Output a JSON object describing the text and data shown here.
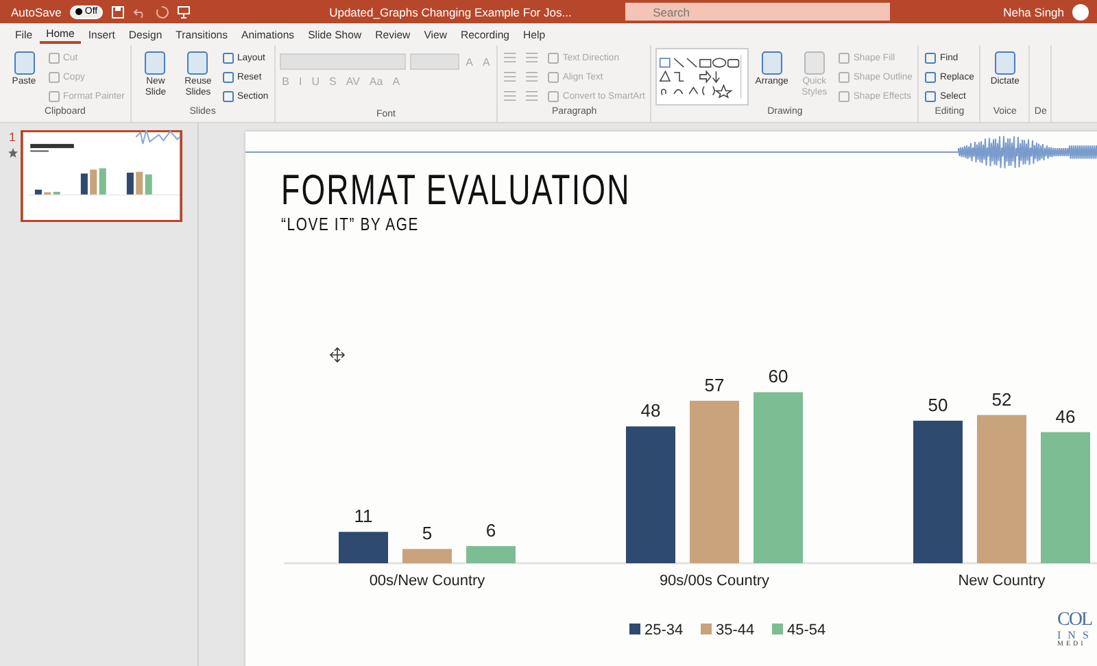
{
  "title_bar": {
    "autosave_label": "AutoSave",
    "autosave_toggle": {
      "label": "Off",
      "on": false
    },
    "file_name": "Updated_Graphs Changing Example For Jos...",
    "search": {
      "placeholder": "Search"
    },
    "user_name": "Neha Singh"
  },
  "tabs": [
    {
      "label": "File",
      "selected": false
    },
    {
      "label": "Home",
      "selected": true
    },
    {
      "label": "Insert",
      "selected": false
    },
    {
      "label": "Design",
      "selected": false
    },
    {
      "label": "Transitions",
      "selected": false
    },
    {
      "label": "Animations",
      "selected": false
    },
    {
      "label": "Slide Show",
      "selected": false
    },
    {
      "label": "Review",
      "selected": false
    },
    {
      "label": "View",
      "selected": false
    },
    {
      "label": "Recording",
      "selected": false
    },
    {
      "label": "Help",
      "selected": false
    }
  ],
  "ribbon": {
    "groups": [
      {
        "name": "Clipboard",
        "items": [
          {
            "kind": "large",
            "label": "Paste",
            "disabled": false
          },
          {
            "kind": "small",
            "label": "Cut",
            "disabled": true
          },
          {
            "kind": "small",
            "label": "Copy",
            "disabled": true
          },
          {
            "kind": "small",
            "label": "Format Painter",
            "disabled": true
          }
        ]
      },
      {
        "name": "Slides",
        "items": [
          {
            "kind": "large",
            "label": "New Slide",
            "disabled": false
          },
          {
            "kind": "large",
            "label": "Reuse Slides",
            "disabled": false
          },
          {
            "kind": "small",
            "label": "Layout",
            "disabled": false
          },
          {
            "kind": "small",
            "label": "Reset",
            "disabled": false
          },
          {
            "kind": "small",
            "label": "Section",
            "disabled": false
          }
        ]
      },
      {
        "name": "Font",
        "rows": [
          [
            {
              "kind": "combo",
              "disabled": true
            },
            {
              "kind": "combo",
              "disabled": true
            },
            {
              "kind": "glyph",
              "label": "A",
              "disabled": true
            },
            {
              "kind": "glyph",
              "label": "A",
              "disabled": true
            }
          ],
          [
            {
              "kind": "glyph",
              "label": "B",
              "disabled": true
            },
            {
              "kind": "glyph",
              "label": "I",
              "disabled": true
            },
            {
              "kind": "glyph",
              "label": "U",
              "disabled": true
            },
            {
              "kind": "glyph",
              "label": "S",
              "disabled": true
            },
            {
              "kind": "glyph",
              "label": "AV",
              "disabled": true
            },
            {
              "kind": "glyph",
              "label": "Aa",
              "disabled": true
            },
            {
              "kind": "glyph",
              "label": "A",
              "disabled": true
            }
          ]
        ]
      },
      {
        "name": "Paragraph",
        "items": [
          {
            "kind": "tool",
            "disabled": true
          },
          {
            "kind": "tool",
            "disabled": true
          },
          {
            "kind": "tool",
            "disabled": true
          },
          {
            "kind": "tool",
            "disabled": true
          },
          {
            "kind": "tool",
            "disabled": true
          },
          {
            "kind": "tool",
            "disabled": true
          },
          {
            "kind": "small",
            "label": "Text Direction",
            "disabled": true
          },
          {
            "kind": "small",
            "label": "Align Text",
            "disabled": true
          },
          {
            "kind": "small",
            "label": "Convert to SmartArt",
            "disabled": true
          }
        ]
      },
      {
        "name": "Drawing",
        "items": [
          {
            "kind": "gallery",
            "disabled": false
          },
          {
            "kind": "large",
            "label": "Arrange",
            "disabled": false
          },
          {
            "kind": "large",
            "label": "Quick Styles",
            "disabled": true
          },
          {
            "kind": "small",
            "label": "Shape Fill",
            "disabled": true
          },
          {
            "kind": "small",
            "label": "Shape Outline",
            "disabled": true
          },
          {
            "kind": "small",
            "label": "Shape Effects",
            "disabled": true
          }
        ]
      },
      {
        "name": "Editing",
        "items": [
          {
            "kind": "small",
            "label": "Find",
            "disabled": false
          },
          {
            "kind": "small",
            "label": "Replace",
            "disabled": false
          },
          {
            "kind": "small",
            "label": "Select",
            "disabled": false
          }
        ]
      },
      {
        "name": "Voice",
        "items": [
          {
            "kind": "large",
            "label": "Dictate",
            "disabled": false
          }
        ]
      },
      {
        "name": "De"
      }
    ]
  },
  "slides": [
    {
      "number": "1",
      "selected": true
    }
  ],
  "slide": {
    "title": "FORMAT EVALUATION",
    "subtitle": "“LOVE IT” BY AGE",
    "logo": [
      "COL",
      "INS",
      "MEDI"
    ],
    "chart_data": {
      "type": "bar",
      "categories": [
        "00s/New Country",
        "90s/00s Country",
        "New Country"
      ],
      "data_labels": true,
      "legend": "bottom",
      "series": [
        {
          "name": "25-34",
          "color": "#2e4a6e",
          "values": [
            11,
            48,
            50
          ]
        },
        {
          "name": "35-44",
          "color": "#c9a37b",
          "values": [
            5,
            57,
            52
          ]
        },
        {
          "name": "45-54",
          "color": "#7dbd93",
          "values": [
            6,
            60,
            46
          ]
        }
      ]
    }
  }
}
